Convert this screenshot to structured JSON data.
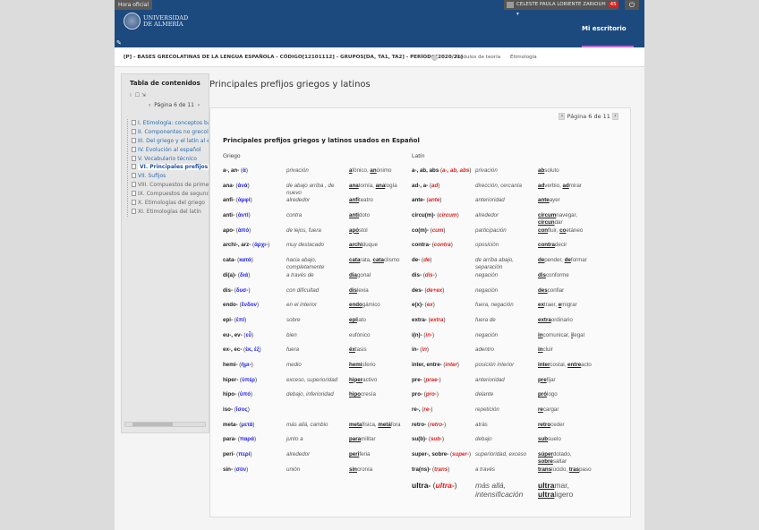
{
  "header": {
    "hora": "Hora oficial",
    "logo_line1": "UNIVERSIDAD",
    "logo_line2": "DE ALMERÍA",
    "user": "CELESTE PAULA LORIENTE ZARIOUH",
    "badge": "45",
    "nav": "Mi escritorio",
    "colors": {
      "header": "#1d4a7e",
      "accent": "#c36bd0"
    }
  },
  "course": {
    "title": "[P] - BASES GRECOLATINAS DE LA LENGUA ESPAÑOLA - CÓDIGO[12101112] - GRUPOS[DA, TA1, TA2] - PERÍODO[2020/21]",
    "links": [
      "Módulos de teoría",
      "Etimología"
    ]
  },
  "sidebar": {
    "title": "Tabla de contenidos",
    "page": "Página 6 de 11",
    "items": [
      "I. Etimología: conceptos bás",
      "II. Componentes no grecola",
      "III. Del griego y el latín al esp",
      "IV. Evolución al español",
      "V. Vocabulario técnico",
      "VI. Principales prefijos gri",
      "VII. Sufijos",
      "VIII. Compuestos de primer",
      "IX. Compuestos de segund",
      "X. Etimologías del griego",
      "XI. Etimologías del latín"
    ]
  },
  "main": {
    "title": "Principales prefijos griegos y latinos",
    "pager": "Página 6 de 11",
    "table_title": "Principales prefijos griegos y latinos usados en Español",
    "greek_header": "Griego",
    "latin_header": "Latín"
  },
  "greek": [
    {
      "p": "a-, an-",
      "o": "ἀ",
      "m": "privación",
      "e": [
        [
          "a",
          1
        ],
        [
          "fónico, ",
          0
        ],
        [
          "an",
          1
        ],
        [
          "ónimo",
          0
        ]
      ]
    },
    {
      "p": "ana-",
      "o": "ἀνά",
      "m": "de abajo arriba , de nuevo",
      "e": [
        [
          "ana",
          1
        ],
        [
          "tomía, ",
          0
        ],
        [
          "ana",
          1
        ],
        [
          "logía",
          0
        ]
      ]
    },
    {
      "p": "anfi-",
      "o": "ἀμφί",
      "m": "alrededor",
      "e": [
        [
          "anfi",
          1
        ],
        [
          "teatro",
          0
        ]
      ]
    },
    {
      "p": "anti-",
      "o": "ἀντί",
      "m": "contra",
      "e": [
        [
          "anti",
          1
        ],
        [
          "doto",
          0
        ]
      ]
    },
    {
      "p": "apo-",
      "o": "ἀπό",
      "m": "de lejos, fuera",
      "e": [
        [
          "apó",
          1
        ],
        [
          "stol",
          0
        ]
      ]
    },
    {
      "p": "archi-, arz-",
      "o": "ἀρχι-",
      "m": "muy destacado",
      "e": [
        [
          "archi",
          1
        ],
        [
          "duque",
          0
        ]
      ]
    },
    {
      "p": "cata-",
      "o": "κατά",
      "m": "hacia abajo, completamente",
      "e": [
        [
          "cata",
          1
        ],
        [
          "rata, ",
          0
        ],
        [
          "cata",
          1
        ],
        [
          "clismo",
          0
        ]
      ]
    },
    {
      "p": "di(a)-",
      "o": "διά",
      "m": "a través de",
      "e": [
        [
          "dia",
          1
        ],
        [
          "gonal",
          0
        ]
      ]
    },
    {
      "p": "dis-",
      "o": "δυσ-",
      "m": "con dificultad",
      "e": [
        [
          "dis",
          1
        ],
        [
          "lexia",
          0
        ]
      ]
    },
    {
      "p": "endo-",
      "o": "ἔνδον",
      "m": "en el interior",
      "e": [
        [
          "endo",
          1
        ],
        [
          "gámico",
          0
        ]
      ]
    },
    {
      "p": "epi-",
      "o": "ἐπί",
      "m": "sobre",
      "e": [
        [
          "epí",
          1
        ],
        [
          "lato",
          0
        ]
      ]
    },
    {
      "p": "eu-, ev-",
      "o": "εὖ",
      "m": "bien",
      "e": [
        [
          "eufónico",
          0
        ]
      ]
    },
    {
      "p": "ex-, ec-",
      "o": "ἐκ, ἐξ",
      "m": "fuera",
      "e": [
        [
          "éx",
          1
        ],
        [
          "tasis",
          0
        ]
      ]
    },
    {
      "p": "hemi-",
      "o": "ἡμι-",
      "m": "medio",
      "e": [
        [
          "hemi",
          1
        ],
        [
          "sferio",
          0
        ]
      ]
    },
    {
      "p": "hiper-",
      "o": "ὑπέρ",
      "m": "exceso, superioridad",
      "e": [
        [
          "hiper",
          1
        ],
        [
          "activo",
          0
        ]
      ]
    },
    {
      "p": "hipo-",
      "o": "ὑπό",
      "m": "debajo, inferioridad",
      "e": [
        [
          "hipo",
          1
        ],
        [
          "cresía",
          0
        ]
      ]
    },
    {
      "p": "iso-",
      "o": "ἴσος",
      "m": "",
      "e": []
    },
    {
      "p": "meta-",
      "o": "μετά",
      "m": "más allá, cambio",
      "e": [
        [
          "meta",
          1
        ],
        [
          "física, ",
          0
        ],
        [
          "metá",
          1
        ],
        [
          "fora",
          0
        ]
      ]
    },
    {
      "p": "para-",
      "o": "παρά",
      "m": "junto a",
      "e": [
        [
          "para",
          1
        ],
        [
          "militar",
          0
        ]
      ]
    },
    {
      "p": "peri-",
      "o": "περί",
      "m": "alrededor",
      "e": [
        [
          "peri",
          1
        ],
        [
          "feria",
          0
        ]
      ]
    },
    {
      "p": "sin-",
      "o": "σύν",
      "m": "unión",
      "e": [
        [
          "sin",
          1
        ],
        [
          "cronía",
          0
        ]
      ]
    }
  ],
  "latin": [
    {
      "p": "a-, ab, abs",
      "o": "a-, ab, abs",
      "m": "privación",
      "e": [
        [
          "ab",
          1
        ],
        [
          "soluto",
          0
        ]
      ]
    },
    {
      "p": "ad-, a-",
      "o": "ad",
      "m": "dirección, cercanía",
      "e": [
        [
          "ad",
          1
        ],
        [
          "verbio, ",
          0
        ],
        [
          "ad",
          1
        ],
        [
          "mirar",
          0
        ]
      ]
    },
    {
      "p": "ante-",
      "o": "ante",
      "m": "anterioridad",
      "e": [
        [
          "ante",
          1
        ],
        [
          "ayer",
          0
        ]
      ]
    },
    {
      "p": "circu(m)-",
      "o": "circum",
      "m": "alrededor",
      "e": [
        [
          "circum",
          1
        ],
        [
          "navegar, ",
          0
        ],
        [
          "circun",
          1
        ],
        [
          "dar",
          0
        ]
      ]
    },
    {
      "p": "co(m)-",
      "o": "cum",
      "m": "participación",
      "e": [
        [
          "con",
          1
        ],
        [
          "fluir, ",
          0
        ],
        [
          "co",
          1
        ],
        [
          "etáneo",
          0
        ]
      ]
    },
    {
      "p": "contra-",
      "o": "contra",
      "m": "oposición",
      "e": [
        [
          "contra",
          1
        ],
        [
          "decir",
          0
        ]
      ]
    },
    {
      "p": "de-",
      "o": "de",
      "m": "de arriba abajo, separación",
      "e": [
        [
          "de",
          1
        ],
        [
          "pender, ",
          0
        ],
        [
          "de",
          1
        ],
        [
          "formar",
          0
        ]
      ]
    },
    {
      "p": "dis-",
      "o": "dis-",
      "m": "negación",
      "e": [
        [
          "dis",
          1
        ],
        [
          "conforme",
          0
        ]
      ]
    },
    {
      "p": "des-",
      "o": "de+ex",
      "m": "negación",
      "e": [
        [
          "des",
          1
        ],
        [
          "confiar",
          0
        ]
      ]
    },
    {
      "p": "e(x)-",
      "o": "ex",
      "m": "fuera, negación",
      "e": [
        [
          "ex",
          1
        ],
        [
          "traer, ",
          0
        ],
        [
          "e",
          1
        ],
        [
          "migrar",
          0
        ]
      ]
    },
    {
      "p": "extra-",
      "o": "extra",
      "m": "fuera de",
      "e": [
        [
          "extra",
          1
        ],
        [
          "ordinario",
          0
        ]
      ]
    },
    {
      "p": "i(n)-",
      "o": "in-",
      "m": "negación",
      "e": [
        [
          "in",
          1
        ],
        [
          "comunicar, ",
          0
        ],
        [
          "i",
          1
        ],
        [
          "legal",
          0
        ]
      ]
    },
    {
      "p": "in-",
      "o": "in",
      "m": "adentro",
      "e": [
        [
          "in",
          1
        ],
        [
          "cluir",
          0
        ]
      ]
    },
    {
      "p": "inter, entre-",
      "o": "inter",
      "m": "posición interior",
      "e": [
        [
          "inter",
          1
        ],
        [
          "costal, ",
          0
        ],
        [
          "entre",
          1
        ],
        [
          "acto",
          0
        ]
      ]
    },
    {
      "p": "pre-",
      "o": "prae-",
      "m": "anterioridad",
      "e": [
        [
          "pre",
          1
        ],
        [
          "fijar",
          0
        ]
      ]
    },
    {
      "p": "pro-",
      "o": "pro-",
      "m": "delante",
      "e": [
        [
          "pró",
          1
        ],
        [
          "logo",
          0
        ]
      ]
    },
    {
      "p": "re-,",
      "o": "re-",
      "m": "repetición",
      "e": [
        [
          "re",
          1
        ],
        [
          "cargar",
          0
        ]
      ]
    },
    {
      "p": "retro-",
      "o": "retro-",
      "m": "atrás",
      "e": [
        [
          "retro",
          1
        ],
        [
          "ceder",
          0
        ]
      ]
    },
    {
      "p": "su(b)-",
      "o": "sub-",
      "m": "debajo",
      "e": [
        [
          "sub",
          1
        ],
        [
          "suelo",
          0
        ]
      ]
    },
    {
      "p": "super-, sobre-",
      "o": "super-",
      "m": "superioridad, exceso",
      "e": [
        [
          "súper",
          1
        ],
        [
          "dotado, ",
          0
        ],
        [
          "sobre",
          1
        ],
        [
          "saltar",
          0
        ]
      ]
    },
    {
      "p": "tra(ns)-",
      "o": "trans",
      "m": "a través",
      "e": [
        [
          "trans",
          1
        ],
        [
          "lúcido, ",
          0
        ],
        [
          "tras",
          1
        ],
        [
          "paso",
          0
        ]
      ]
    },
    {
      "p": "ultra-",
      "o": "ultra-",
      "m": "más allá, intensificación",
      "e": [
        [
          "ultra",
          1
        ],
        [
          "mar, ",
          0
        ],
        [
          "ultra",
          1
        ],
        [
          "ligero",
          0
        ]
      ]
    }
  ]
}
